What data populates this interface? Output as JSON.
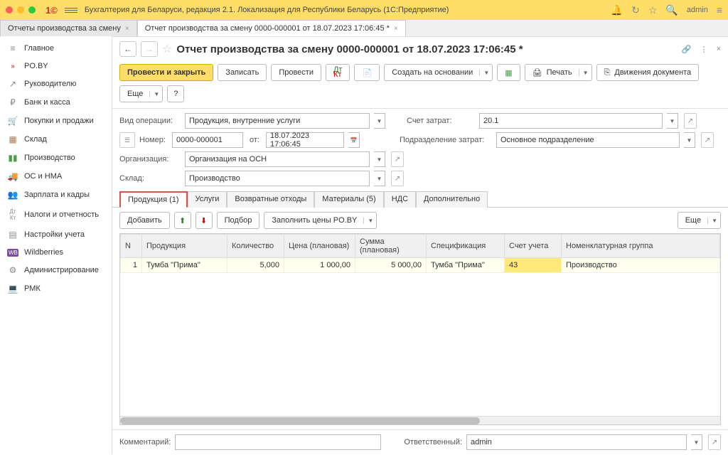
{
  "titlebar": {
    "app_title": "Бухгалтерия для Беларуси, редакция 2.1. Локализация для Республики Беларусь   (1С:Предприятие)",
    "user": "admin"
  },
  "tabs": [
    {
      "label": "Отчеты производства за смену",
      "active": false
    },
    {
      "label": "Отчет производства за смену 0000-000001 от 18.07.2023 17:06:45 *",
      "active": true
    }
  ],
  "sidebar": [
    {
      "label": "Главное",
      "icon": "≡"
    },
    {
      "label": "PO.BY",
      "icon": "»",
      "cls": "icon-pobY"
    },
    {
      "label": "Руководителю",
      "icon": "↗"
    },
    {
      "label": "Банк и касса",
      "icon": "₽"
    },
    {
      "label": "Покупки и продажи",
      "icon": "🛒"
    },
    {
      "label": "Склад",
      "icon": "▦"
    },
    {
      "label": "Производство",
      "icon": "▮▮",
      "cls": "icon-green"
    },
    {
      "label": "ОС и НМА",
      "icon": "🚚"
    },
    {
      "label": "Зарплата и кадры",
      "icon": "👥"
    },
    {
      "label": "Налоги и отчетность",
      "icon": "Дт"
    },
    {
      "label": "Настройки учета",
      "icon": "▤"
    },
    {
      "label": "Wildberries",
      "icon": "WB",
      "cls": "icon-purple"
    },
    {
      "label": "Администрирование",
      "icon": "⚙"
    },
    {
      "label": "РМК",
      "icon": "💻"
    }
  ],
  "doc": {
    "title": "Отчет производства за смену 0000-000001 от 18.07.2023 17:06:45 *"
  },
  "toolbar": {
    "post_close": "Провести и закрыть",
    "save": "Записать",
    "post": "Провести",
    "create_based": "Создать на основании",
    "print": "Печать",
    "movements": "Движения документа",
    "more": "Еще"
  },
  "form": {
    "op_type_label": "Вид операции:",
    "op_type": "Продукция, внутренние услуги",
    "expense_acc_label": "Счет затрат:",
    "expense_acc": "20.1",
    "number_label": "Номер:",
    "number": "0000-000001",
    "from_label": "от:",
    "date": "18.07.2023 17:06:45",
    "subdiv_label": "Подразделение затрат:",
    "subdiv": "Основное подразделение",
    "org_label": "Организация:",
    "org": "Организация на ОСН",
    "warehouse_label": "Склад:",
    "warehouse": "Производство"
  },
  "doc_tabs": [
    "Продукция (1)",
    "Услуги",
    "Возвратные отходы",
    "Материалы (5)",
    "НДС",
    "Дополнительно"
  ],
  "tbl_toolbar": {
    "add": "Добавить",
    "pick": "Подбор",
    "fill_prices": "Заполнить цены PO.BY",
    "more": "Еще"
  },
  "table": {
    "headers": [
      "N",
      "Продукция",
      "Количество",
      "Цена (плановая)",
      "Сумма (плановая)",
      "Спецификация",
      "Счет учета",
      "Номенклатурная группа"
    ],
    "row": {
      "n": "1",
      "product": "Тумба \"Прима\"",
      "qty": "5,000",
      "price": "1 000,00",
      "sum": "5 000,00",
      "spec": "Тумба \"Прима\"",
      "acct": "43",
      "nomgroup": "Производство"
    }
  },
  "footer": {
    "comment_label": "Комментарий:",
    "comment": "",
    "responsible_label": "Ответственный:",
    "responsible": "admin"
  }
}
